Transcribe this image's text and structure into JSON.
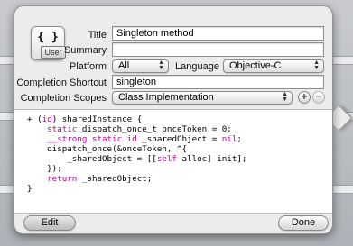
{
  "icon": {
    "name": "snippet-braces-icon",
    "glyph": "{ }",
    "badge": "User"
  },
  "fields": {
    "title_label": "Title",
    "title_value": "Singleton method",
    "summary_label": "Summary",
    "summary_value": "",
    "platform_label": "Platform",
    "platform_value": "All",
    "language_label": "Language",
    "language_value": "Objective-C",
    "shortcut_label": "Completion Shortcut",
    "shortcut_value": "singleton",
    "scopes_label": "Completion Scopes",
    "scopes_value": "Class Implementation"
  },
  "code_lines": [
    [
      {
        "t": "+ ("
      },
      {
        "t": "id",
        "k": true
      },
      {
        "t": ") sharedInstance {"
      }
    ],
    [
      {
        "t": "    "
      },
      {
        "t": "static",
        "k": true
      },
      {
        "t": " dispatch_once_t onceToken = 0;"
      }
    ],
    [
      {
        "t": "    "
      },
      {
        "t": "__strong static id",
        "k": true
      },
      {
        "t": " _sharedObject = "
      },
      {
        "t": "nil",
        "k": true
      },
      {
        "t": ";"
      }
    ],
    [
      {
        "t": "    dispatch_once(&onceToken, ^{"
      }
    ],
    [
      {
        "t": "        _sharedObject = [["
      },
      {
        "t": "self",
        "k": true
      },
      {
        "t": " alloc] init];"
      }
    ],
    [
      {
        "t": "    });"
      }
    ],
    [
      {
        "t": "    "
      },
      {
        "t": "return",
        "k": true
      },
      {
        "t": " _sharedObject;"
      }
    ],
    [
      {
        "t": "}"
      }
    ]
  ],
  "buttons": {
    "edit": "Edit",
    "done": "Done",
    "add": "+",
    "remove": "−"
  },
  "colors": {
    "keyword": "#aa0d91",
    "popover_bg": "#ececec"
  }
}
